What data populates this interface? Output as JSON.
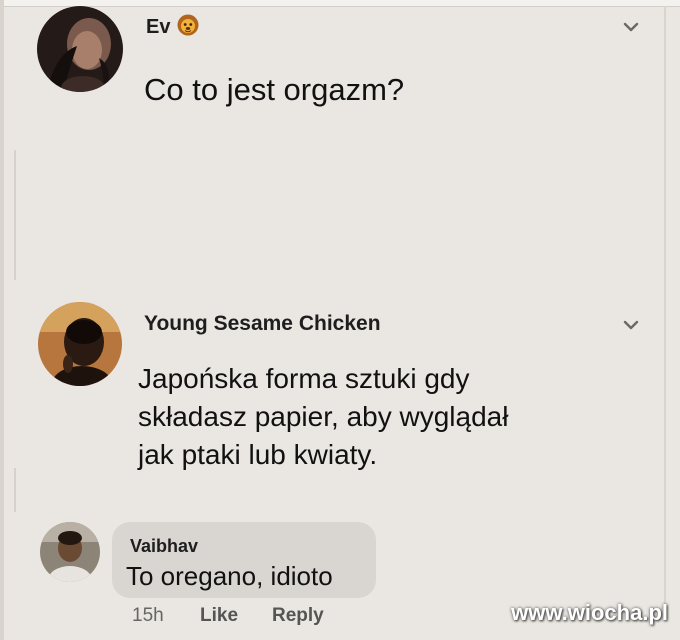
{
  "comments": [
    {
      "author": "Ev",
      "author_badge": "lion-face-emoji",
      "text_lines": [
        "Co to jest orgazm?"
      ]
    },
    {
      "author": "Young Sesame Chicken",
      "text_lines": [
        "Japońska forma sztuki gdy",
        "składasz papier, aby wyglądał",
        "jak ptaki lub kwiaty."
      ]
    },
    {
      "author": "Vaibhav",
      "text_lines": [
        "To oregano, idioto"
      ],
      "time": "15h",
      "like_label": "Like",
      "reply_label": "Reply"
    }
  ],
  "watermark": "www.wiocha.pl",
  "colors": {
    "background": "#eae6e1",
    "bubble": "#d9d5d1",
    "text": "#111111",
    "meta": "#555555"
  }
}
